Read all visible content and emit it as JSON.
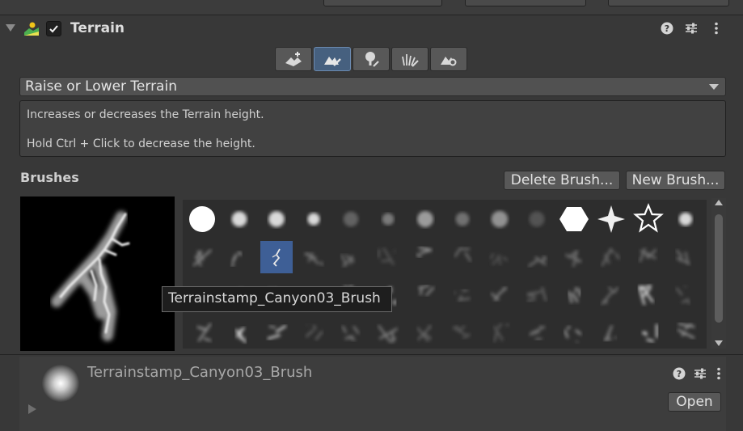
{
  "component": {
    "title": "Terrain",
    "enabled": true,
    "icons": [
      "help-icon",
      "preset-icon",
      "more-options-icon"
    ]
  },
  "toolbar": {
    "tools": [
      {
        "name": "create-neighbor-terrains",
        "active": false
      },
      {
        "name": "paint-terrain",
        "active": true
      },
      {
        "name": "paint-trees",
        "active": false
      },
      {
        "name": "paint-details",
        "active": false
      },
      {
        "name": "terrain-settings",
        "active": false
      }
    ]
  },
  "tool_dropdown": {
    "selected": "Raise or Lower Terrain"
  },
  "help": {
    "line1": "Increases or decreases the Terrain height.",
    "line2": "Hold Ctrl + Click to decrease the height."
  },
  "brushes": {
    "label": "Brushes",
    "delete_label": "Delete Brush...",
    "new_label": "New Brush...",
    "tooltip": "Terrainstamp_Canyon03_Brush",
    "selected_index": 16,
    "columns": 14,
    "rows": 4
  },
  "asset": {
    "name": "Terrainstamp_Canyon03_Brush",
    "open_label": "Open"
  },
  "colors": {
    "background": "#383838",
    "selected_tool": "#46607f",
    "selected_brush": "#3e5f96"
  }
}
